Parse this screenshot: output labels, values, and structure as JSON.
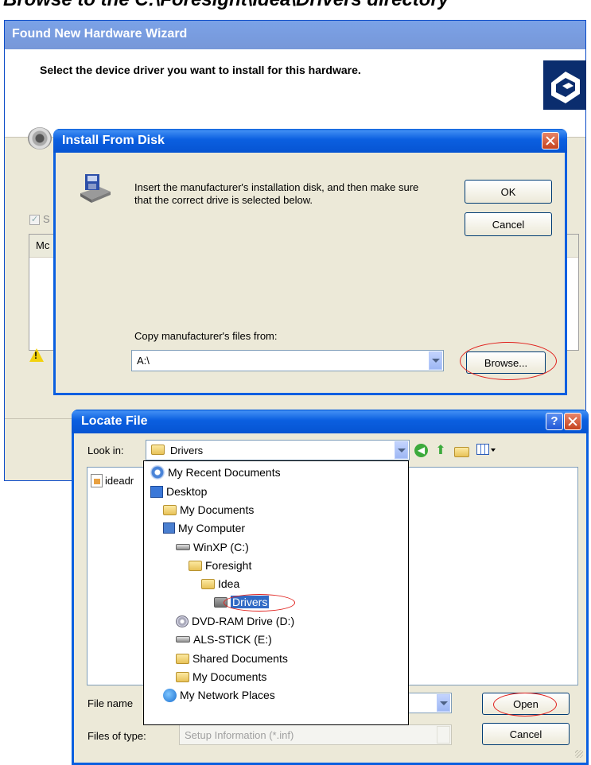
{
  "header_text": "Browse to the C:\\Foresight\\Idea\\Drivers directory",
  "wizard": {
    "title": "Found New Hardware Wizard",
    "heading": "Select the device driver you want to install for this hardware.",
    "partial_checkbox_label": "S",
    "partial_column_label": "Mc"
  },
  "install_from_disk": {
    "title": "Install From Disk",
    "message": "Insert the manufacturer's installation disk, and then make sure that the correct drive is selected below.",
    "ok_label": "OK",
    "cancel_label": "Cancel",
    "copy_label": "Copy manufacturer's files from:",
    "path_value": "A:\\",
    "browse_label": "Browse..."
  },
  "locate_file": {
    "title": "Locate File",
    "help_label": "?",
    "look_in_label": "Look in:",
    "look_in_value": "Drivers",
    "file_item_partial": "ideadr",
    "file_name_label": "File name",
    "files_of_type_label": "Files of type:",
    "files_of_type_value": "Setup Information (*.inf)",
    "open_label": "Open",
    "cancel_label": "Cancel",
    "dropdown_items": [
      {
        "label": "My Recent Documents",
        "icon": "recent-documents-icon"
      },
      {
        "label": "Desktop",
        "icon": "desktop-icon"
      },
      {
        "label": "My Documents",
        "icon": "my-documents-icon"
      },
      {
        "label": "My Computer",
        "icon": "my-computer-icon"
      },
      {
        "label": "WinXP (C:)",
        "icon": "hard-drive-icon"
      },
      {
        "label": "Foresight",
        "icon": "folder-icon"
      },
      {
        "label": "Idea",
        "icon": "folder-icon"
      },
      {
        "label": "Drivers",
        "icon": "open-folder-icon",
        "selected": true
      },
      {
        "label": "DVD-RAM Drive (D:)",
        "icon": "dvd-drive-icon"
      },
      {
        "label": "ALS-STICK (E:)",
        "icon": "removable-drive-icon"
      },
      {
        "label": "Shared Documents",
        "icon": "folder-icon"
      },
      {
        "label": "My Documents",
        "icon": "folder-icon"
      },
      {
        "label": "My Network Places",
        "icon": "network-places-icon"
      }
    ]
  },
  "colors": {
    "titlebar": "#0b5fe0",
    "dialog_bg": "#ece9d8",
    "selection": "#316ac5",
    "annotation": "#e0201c"
  }
}
